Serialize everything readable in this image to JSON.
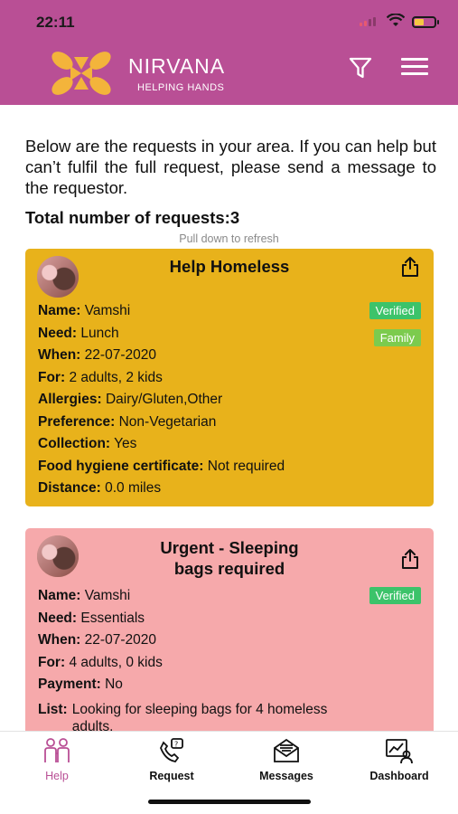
{
  "status_bar": {
    "time": "22:11"
  },
  "header": {
    "brand": "NIRVANA",
    "tagline": "HELPING HANDS",
    "logo_colors": [
      "#f3b43b",
      "#f7c751"
    ]
  },
  "intro_text": "Below are the requests in your area. If you can help but can’t fulfil the full request, please send a message to the requestor.",
  "total_label": "Total number of requests:3",
  "pull_hint": "Pull down to refresh",
  "cards": [
    {
      "title": "Help Homeless",
      "color": "#e8b21b",
      "badges": [
        "Verified",
        "Family"
      ],
      "fields": [
        {
          "label": "Name:",
          "value": "Vamshi"
        },
        {
          "label": "Need:",
          "value": "Lunch"
        },
        {
          "label": "When:",
          "value": "22-07-2020"
        },
        {
          "label": "For:",
          "value": "2 adults, 2 kids"
        },
        {
          "label": "Allergies:",
          "value": "Dairy/Gluten,Other"
        },
        {
          "label": "Preference:",
          "value": "Non-Vegetarian"
        },
        {
          "label": "Collection:",
          "value": "Yes"
        },
        {
          "label": "Food hygiene certificate:",
          "value": "Not required"
        },
        {
          "label": "Distance:",
          "value": "0.0 miles"
        }
      ]
    },
    {
      "title_line1": "Urgent - Sleeping",
      "title_line2": "bags required",
      "color": "#f6a9ab",
      "badges": [
        "Verified"
      ],
      "fields": [
        {
          "label": "Name:",
          "value": "Vamshi"
        },
        {
          "label": "Need:",
          "value": "Essentials"
        },
        {
          "label": "When:",
          "value": "22-07-2020"
        },
        {
          "label": "For:",
          "value": "4 adults, 0 kids"
        },
        {
          "label": "Payment:",
          "value": "No"
        },
        {
          "label": "List:",
          "value": "Looking for sleeping bags for 4 homeless adults."
        }
      ]
    }
  ],
  "bottom_nav": [
    {
      "label": "Help",
      "icon": "people-icon",
      "active": true
    },
    {
      "label": "Request",
      "icon": "request-icon",
      "active": false
    },
    {
      "label": "Messages",
      "icon": "messages-icon",
      "active": false
    },
    {
      "label": "Dashboard",
      "icon": "dashboard-icon",
      "active": false
    }
  ],
  "accent_color": "#b94f95"
}
